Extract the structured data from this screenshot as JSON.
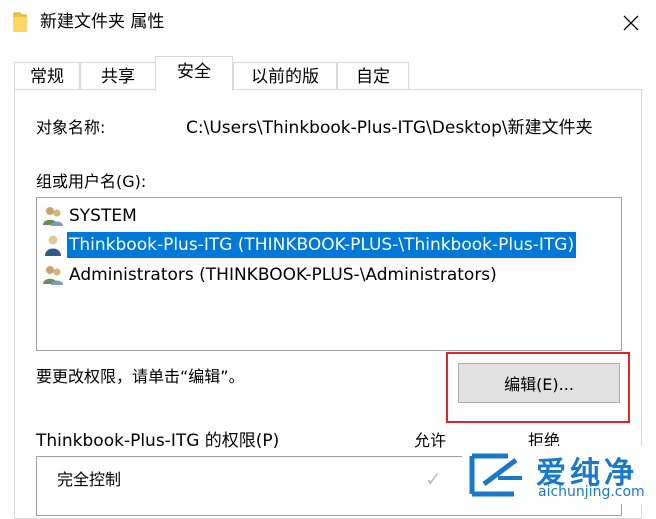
{
  "window": {
    "title": "新建文件夹 属性",
    "close_icon": "close-icon"
  },
  "tabs": [
    {
      "label": "常规"
    },
    {
      "label": "共享"
    },
    {
      "label": "安全"
    },
    {
      "label": "以前的版本"
    },
    {
      "label": "自定义"
    }
  ],
  "active_tab": "安全",
  "object": {
    "label": "对象名称:",
    "value": "C:\\Users\\Thinkbook-Plus-ITG\\Desktop\\新建文件夹"
  },
  "groups": {
    "label": "组或用户名(G):",
    "items": [
      {
        "name": "SYSTEM",
        "icon": "users-group-icon"
      },
      {
        "name": "Thinkbook-Plus-ITG (THINKBOOK-PLUS-\\Thinkbook-Plus-ITG)",
        "icon": "user-icon",
        "selected": true
      },
      {
        "name": "Administrators (THINKBOOK-PLUS-\\Administrators)",
        "icon": "users-group-icon"
      }
    ]
  },
  "edit_hint": "要更改权限，请单击“编辑”。",
  "edit_button": "编辑(E)...",
  "permissions": {
    "label": "Thinkbook-Plus-ITG 的权限(P)",
    "allow_header": "允许",
    "deny_header": "拒绝",
    "rows": [
      {
        "name": "完全控制"
      }
    ]
  },
  "watermark": {
    "text": "爱纯净",
    "url": "aichunjing.com",
    "color": "#1a78c8"
  }
}
